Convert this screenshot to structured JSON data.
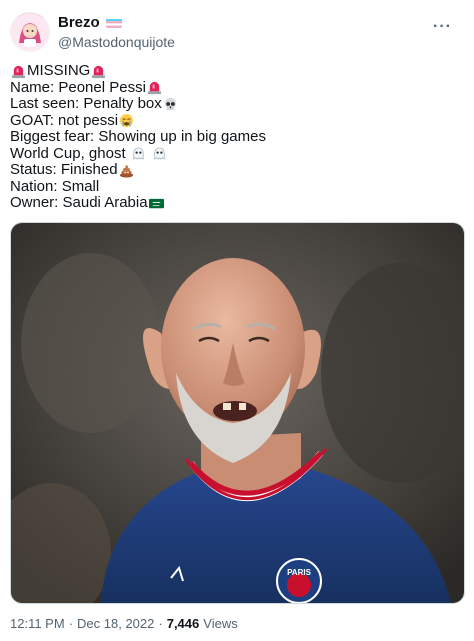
{
  "author": {
    "display_name": "Brezo",
    "handle": "@Mastodonquijote",
    "flag_icon": "transgender-flag-icon"
  },
  "tweet": {
    "lines": [
      {
        "pre_icon": "police-light-icon",
        "text": "MISSING",
        "post_icon": "police-light-icon"
      },
      {
        "text": "Name: Peonel Pessi",
        "post_icon": "police-light-icon"
      },
      {
        "text": "Last seen: Penalty box",
        "post_icon": "skull-icon"
      },
      {
        "text": "GOAT: not pessi",
        "post_icon": "crying-face-icon"
      },
      {
        "text": "Biggest fear: Showing up in big games"
      },
      {
        "text": "World Cup, ghost",
        "post_icon": "ghost-icon ghost-icon"
      },
      {
        "text": "Status: Finished",
        "post_icon": "poop-icon"
      },
      {
        "text": "Nation: Small"
      },
      {
        "text": "Owner: Saudi Arabia",
        "post_icon": "saudi-flag-icon"
      }
    ]
  },
  "media": {
    "jersey_badge": "PARIS"
  },
  "meta": {
    "time": "12:11 PM",
    "separator": "·",
    "date": "Dec 18, 2022",
    "views_count": "7,446",
    "views_label": "Views"
  },
  "colors": {
    "text": "#0f1419",
    "secondary": "#536471",
    "jersey": "#1c3a78"
  }
}
